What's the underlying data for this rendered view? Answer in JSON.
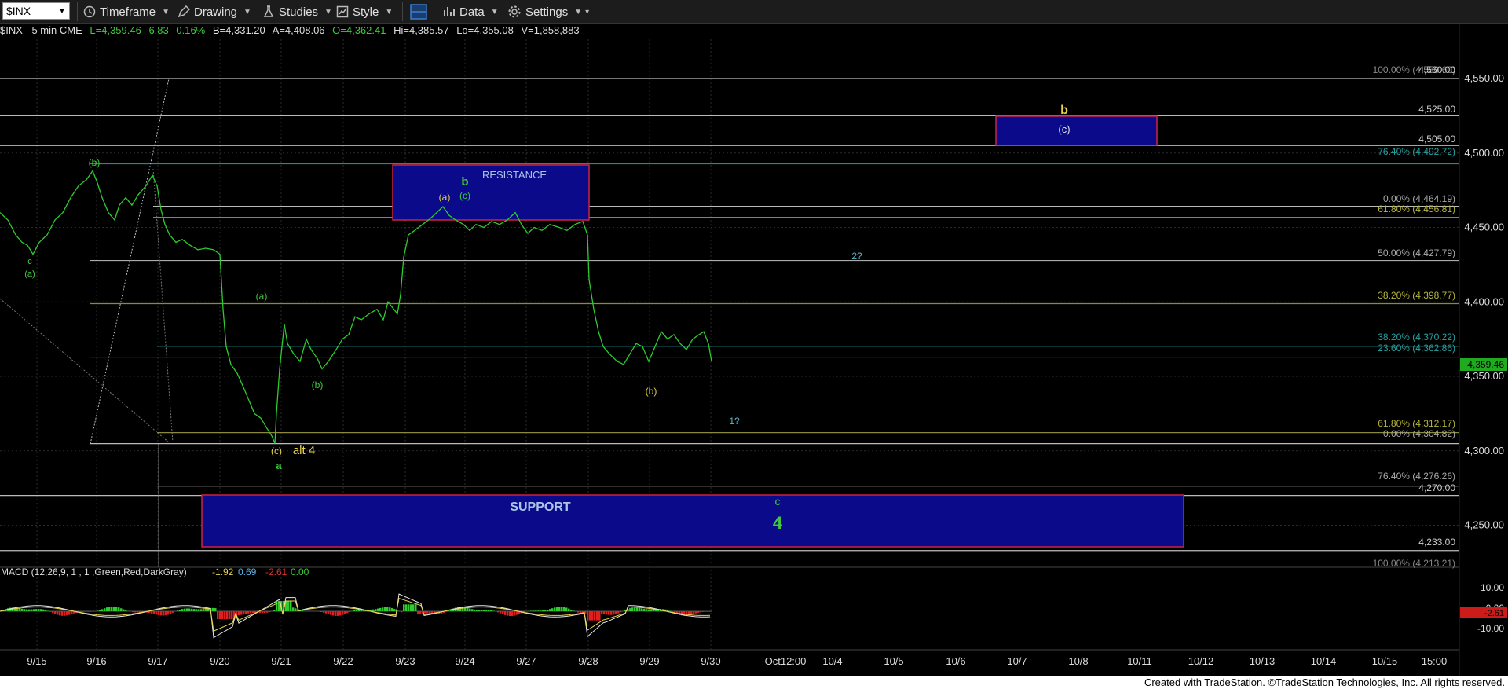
{
  "toolbar": {
    "symbol": "$INX",
    "timeframe": "Timeframe",
    "drawing": "Drawing",
    "studies": "Studies",
    "style": "Style",
    "data": "Data",
    "settings": "Settings"
  },
  "info": {
    "symbol": "$INX - 5 min  CME",
    "last": "L=4,359.46",
    "change": "6.83",
    "pct": "0.16%",
    "bid": "B=4,331.20",
    "ask": "A=4,408.06",
    "open": "O=4,362.41",
    "high": "Hi=4,385.57",
    "low": "Lo=4,355.08",
    "volume": "V=1,858,883"
  },
  "colors": {
    "bg": "#000000",
    "price_line": "#2ecc2e",
    "macd_pos": "#2ecc2e",
    "macd_neg": "#e02020",
    "zone_fill": "#0a0a8a",
    "zone_border": "#cc2244",
    "label_green": "#3ec93e",
    "label_yellow": "#e8d34a",
    "label_cyan": "#5ab4c8"
  },
  "price_axis": {
    "ticks": [
      "4,550.00",
      "4,500.00",
      "4,450.00",
      "4,400.00",
      "4,350.00",
      "4,300.00",
      "4,250.00"
    ],
    "last_price": "4,359.46",
    "levels": [
      "4,560.00",
      "4,525.00",
      "4,505.00",
      "4,270.00",
      "4,233.00"
    ]
  },
  "fib_labels": [
    "100.00% (4,550.60)",
    "76.40% (4,492.72)",
    "0.00% (4,464.19)",
    "61.80% (4,456.81)",
    "50.00% (4,427.79)",
    "38.20% (4,398.77)",
    "38.20% (4,370.22)",
    "23.60% (4,362.86)",
    "61.80% (4,312.17)",
    "0.00% (4,304.82)",
    "76.40% (4,276.26)",
    "100.00% (4,213.21)"
  ],
  "zones": {
    "resistance": "RESISTANCE",
    "support": "SUPPORT",
    "target": "(c)"
  },
  "wave_labels": {
    "c_left": "c",
    "a_left": "(a)",
    "b_top": "(b)",
    "a_mid": "(a)",
    "b_mid": "(b)",
    "c_low": "(c)",
    "a_low": "a",
    "alt4": "alt 4",
    "a_res": "(a)",
    "b_res": "b",
    "c_res": "(c)",
    "b_yel": "(b)",
    "q1": "1?",
    "q2": "2?",
    "c_sup": "c",
    "four": "4",
    "b_target": "b"
  },
  "macd": {
    "label": "MACD (12,26,9, 1 , 1 ,Green,Red,DarkGray)",
    "v1": "-1.92",
    "v2": "0.69",
    "v3": "-2.61",
    "v4": "0.00",
    "ticks": [
      "10.00",
      "0.00",
      "-10.00"
    ],
    "last": "-2.61"
  },
  "date_axis": [
    "9/15",
    "9/16",
    "9/17",
    "9/20",
    "9/21",
    "9/22",
    "9/23",
    "9/24",
    "9/27",
    "9/28",
    "9/29",
    "9/30",
    "Oct12:00",
    "10/4",
    "10/5",
    "10/6",
    "10/7",
    "10/8",
    "10/11",
    "10/12",
    "10/13",
    "10/14",
    "10/15",
    "15:00"
  ],
  "footer": "Created with TradeStation. ©TradeStation Technologies, Inc. All rights reserved."
}
